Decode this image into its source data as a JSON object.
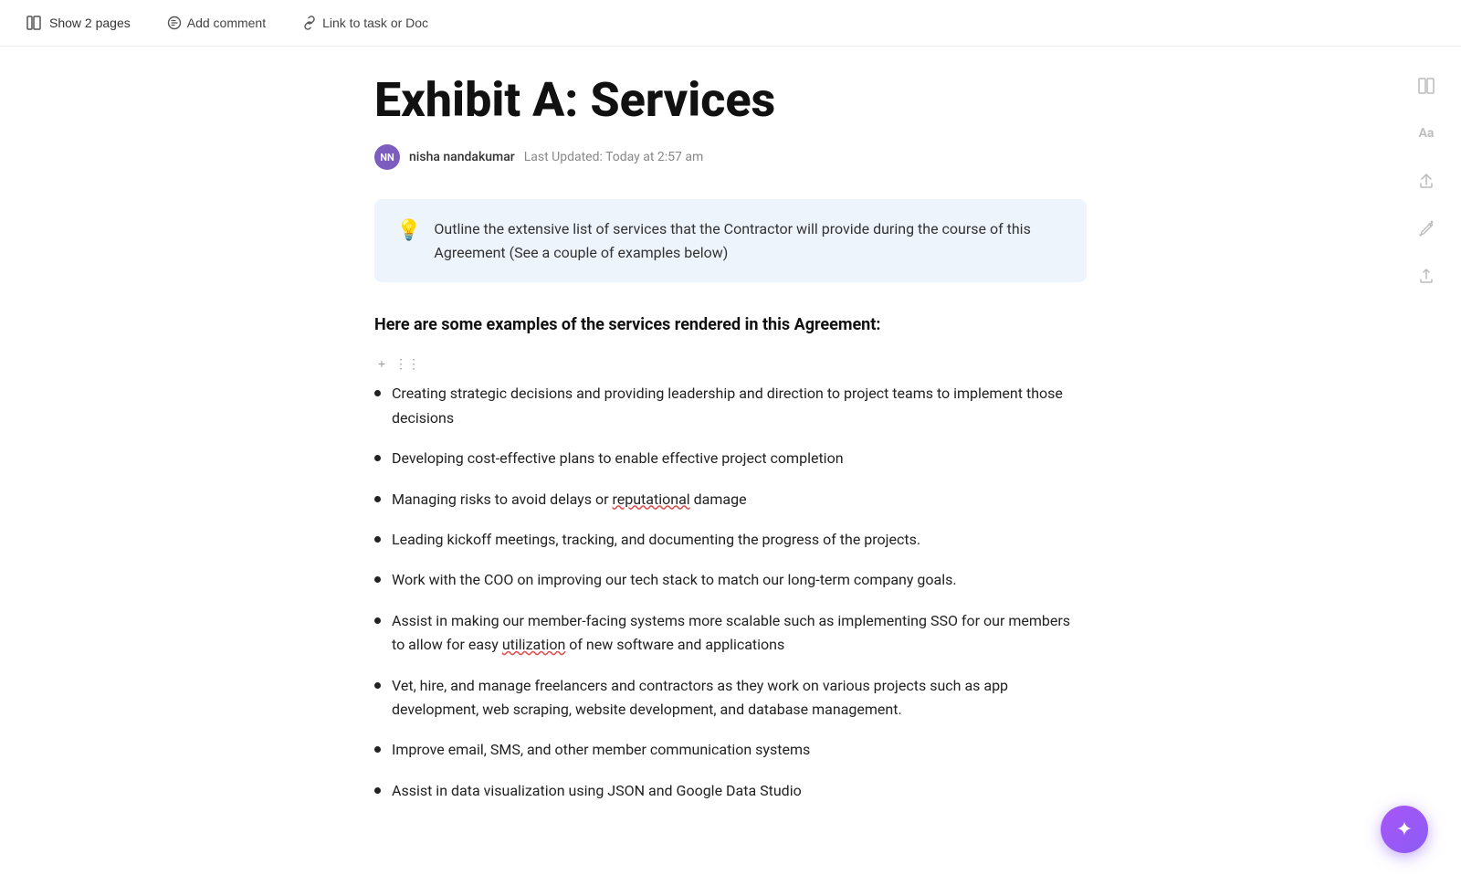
{
  "toolbar": {
    "show_pages_label": "Show 2 pages",
    "add_comment_label": "Add comment",
    "link_to_task_label": "Link to task or Doc"
  },
  "sidebar_icons": [
    {
      "name": "layout-icon",
      "symbol": "⊞"
    },
    {
      "name": "font-icon",
      "symbol": "Aa"
    },
    {
      "name": "share-icon",
      "symbol": "↗"
    },
    {
      "name": "edit-icon",
      "symbol": "✏"
    },
    {
      "name": "export-icon",
      "symbol": "↑"
    }
  ],
  "doc": {
    "title": "Exhibit A: Services",
    "author": {
      "initials": "NN",
      "name": "nisha nandakumar",
      "last_updated": "Last Updated:  Today at 2:57 am"
    },
    "callout": {
      "icon": "💡",
      "text": "Outline the extensive list of services that the Contractor will provide during the course of this Agreement (See a couple of examples below)"
    },
    "section_heading": "Here are some examples of the services rendered in this Agreement:",
    "bullet_items": [
      {
        "id": 1,
        "text": "Creating strategic decisions and providing leadership and direction to project teams to implement those decisions",
        "underline_word": null
      },
      {
        "id": 2,
        "text": "Developing cost-effective plans to enable effective project completion",
        "underline_word": null
      },
      {
        "id": 3,
        "text": "Managing risks to avoid delays or reputational damage",
        "underline_word": "reputational"
      },
      {
        "id": 4,
        "text": "Leading kickoff meetings, tracking, and documenting the progress of the projects.",
        "underline_word": null
      },
      {
        "id": 5,
        "text": "Work with the COO on improving our tech stack to match our long-term company goals.",
        "underline_word": null
      },
      {
        "id": 6,
        "text": "Assist in making our member-facing systems more scalable such as implementing SSO for our members to allow for easy utilization of new software and applications",
        "underline_word": "utilization"
      },
      {
        "id": 7,
        "text": "Vet, hire, and manage freelancers and contractors as they work on various projects such as app development, web scraping, website development, and database management.",
        "underline_word": null
      },
      {
        "id": 8,
        "text": "Improve email, SMS, and other member communication systems",
        "underline_word": null
      },
      {
        "id": 9,
        "text": "Assist in data visualization using JSON and Google Data Studio",
        "underline_word": null,
        "partial": true
      }
    ]
  },
  "fab": {
    "icon": "✦"
  }
}
